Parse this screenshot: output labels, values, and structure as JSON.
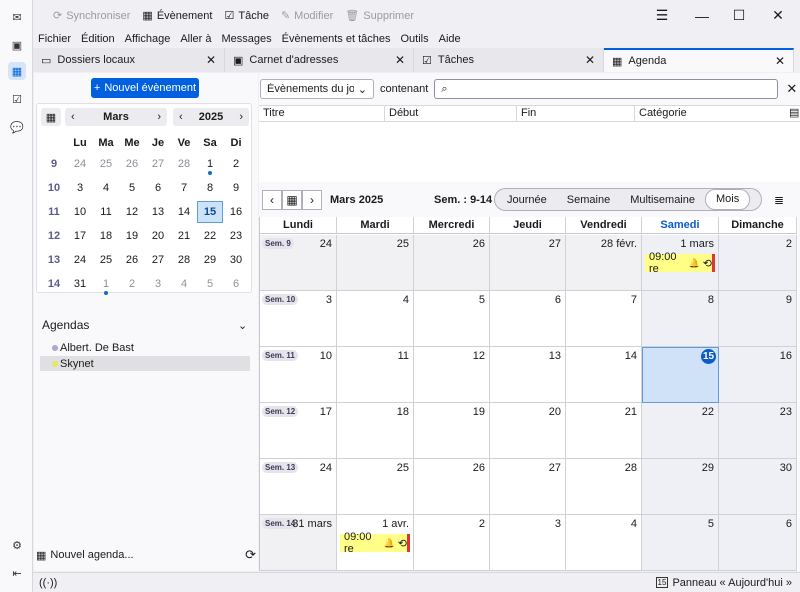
{
  "toolbar": {
    "sync": "Synchroniser",
    "event": "Évènement",
    "task": "Tâche",
    "edit": "Modifier",
    "delete": "Supprimer"
  },
  "menu": [
    "Fichier",
    "Édition",
    "Affichage",
    "Aller à",
    "Messages",
    "Évènements et tâches",
    "Outils",
    "Aide"
  ],
  "tabs": [
    "Dossiers locaux",
    "Carnet d'adresses",
    "Tâches",
    "Agenda"
  ],
  "left": {
    "new_event": "Nouvel évènement",
    "month": "Mars",
    "year": "2025",
    "weekdays": [
      "Lu",
      "Ma",
      "Me",
      "Je",
      "Ve",
      "Sa",
      "Di"
    ],
    "weeks": [
      {
        "wk": "9",
        "days": [
          "24",
          "25",
          "26",
          "27",
          "28",
          "1",
          "2"
        ]
      },
      {
        "wk": "10",
        "days": [
          "3",
          "4",
          "5",
          "6",
          "7",
          "8",
          "9"
        ]
      },
      {
        "wk": "11",
        "days": [
          "10",
          "11",
          "12",
          "13",
          "14",
          "15",
          "16"
        ]
      },
      {
        "wk": "12",
        "days": [
          "17",
          "18",
          "19",
          "20",
          "21",
          "22",
          "23"
        ]
      },
      {
        "wk": "13",
        "days": [
          "24",
          "25",
          "26",
          "27",
          "28",
          "29",
          "30"
        ]
      },
      {
        "wk": "14",
        "days": [
          "31",
          "1",
          "2",
          "3",
          "4",
          "5",
          "6"
        ]
      }
    ],
    "agendas_title": "Agendas",
    "calendars": [
      {
        "name": "Albert. De Bast",
        "color": "#a8a8d8"
      },
      {
        "name": "Skynet",
        "color": "#ffff88"
      }
    ],
    "new_agenda": "Nouvel agenda..."
  },
  "filter": {
    "dropdown": "Évènements du jour",
    "contains": "contenant"
  },
  "columns": [
    "Titre",
    "Début",
    "Fin",
    "Catégorie"
  ],
  "view": {
    "title": "Mars 2025",
    "weeks": "Sem. : 9-14",
    "modes": [
      "Journée",
      "Semaine",
      "Multisemaine",
      "Mois"
    ],
    "selected_mode": "Mois",
    "dayheaders": [
      "Lundi",
      "Mardi",
      "Mercredi",
      "Jeudi",
      "Vendredi",
      "Samedi",
      "Dimanche"
    ],
    "rows": [
      {
        "wk": "Sem. 9",
        "days": [
          "24",
          "25",
          "26",
          "27",
          "28 févr.",
          "1 mars",
          "2"
        ]
      },
      {
        "wk": "Sem. 10",
        "days": [
          "3",
          "4",
          "5",
          "6",
          "7",
          "8",
          "9"
        ]
      },
      {
        "wk": "Sem. 11",
        "days": [
          "10",
          "11",
          "12",
          "13",
          "14",
          "15",
          "16"
        ]
      },
      {
        "wk": "Sem. 12",
        "days": [
          "17",
          "18",
          "19",
          "20",
          "21",
          "22",
          "23"
        ]
      },
      {
        "wk": "Sem. 13",
        "days": [
          "24",
          "25",
          "26",
          "27",
          "28",
          "29",
          "30"
        ]
      },
      {
        "wk": "Sem. 14",
        "days": [
          "31 mars",
          "1 avr.",
          "2",
          "3",
          "4",
          "5",
          "6"
        ]
      }
    ],
    "event_label": "09:00 re"
  },
  "status": {
    "today_pane": "Panneau « Aujourd'hui »",
    "today_num": "15"
  }
}
